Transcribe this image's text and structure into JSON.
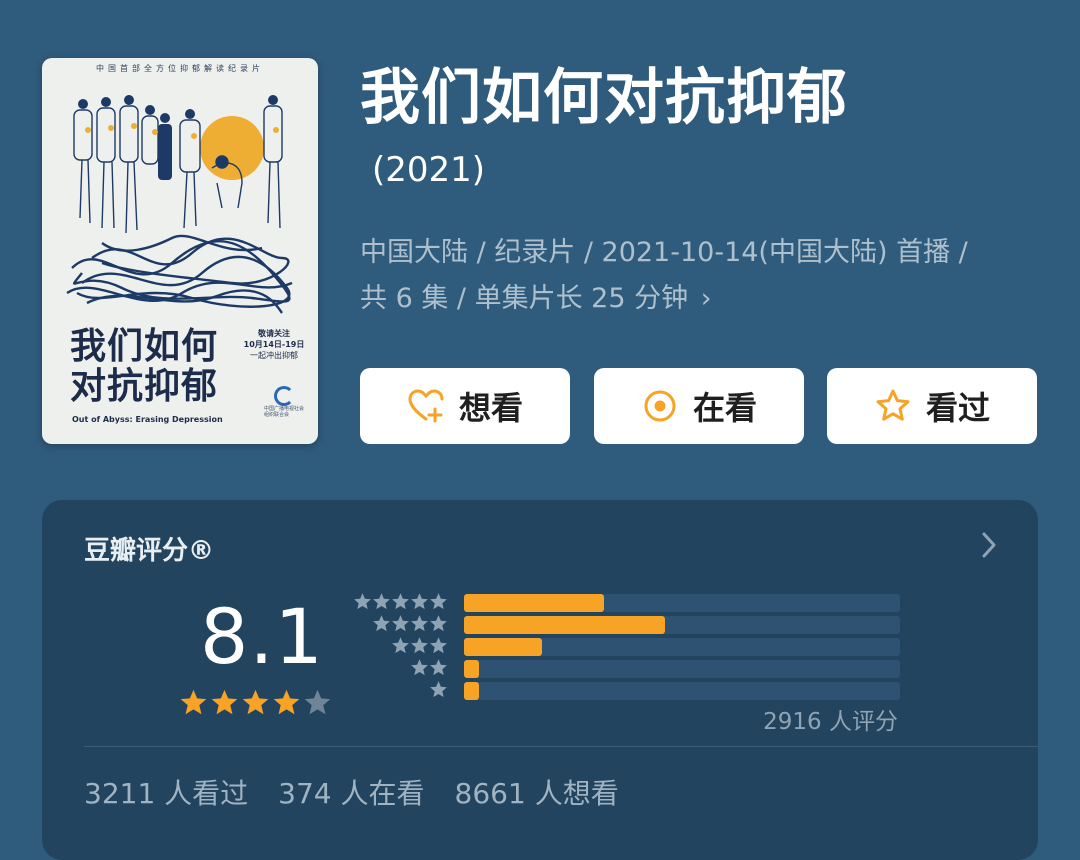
{
  "poster": {
    "tagline": "中国首部全方位抑郁解读纪录片",
    "title_line1": "我们如何",
    "title_line2": "对抗抑郁",
    "subtitle": "Out of Abyss: Erasing Depression",
    "notice_line1": "敬请关注",
    "notice_line2": "10月14日-19日",
    "notice_line3": "一起冲出抑郁",
    "logo_text": "中国广播电视社会组织联合会"
  },
  "header": {
    "title": "我们如何对抗抑郁",
    "year": "(2021)",
    "meta_line1": "中国大陆 / 纪录片 / 2021-10-14(中国大陆) 首播 /",
    "meta_line2": "共 6 集 / 单集片长 25 分钟"
  },
  "buttons": {
    "want": "想看",
    "watching": "在看",
    "watched": "看过"
  },
  "rating": {
    "title": "豆瓣评分®",
    "score": "8.1",
    "stars_filled": 4,
    "stars_total": 5,
    "count_text": "2916 人评分",
    "distribution": [
      {
        "stars": 5,
        "fraction": 0.32
      },
      {
        "stars": 4,
        "fraction": 0.46
      },
      {
        "stars": 3,
        "fraction": 0.18
      },
      {
        "stars": 2,
        "fraction": 0.035
      },
      {
        "stars": 1,
        "fraction": 0.035
      }
    ]
  },
  "stats": {
    "watched": "3211 人看过",
    "watching": "374 人在看",
    "want": "8661 人想看"
  },
  "colors": {
    "background": "#2f5b7c",
    "card": "#23445f",
    "accent": "#f7a325",
    "meta_text": "#aec0cd"
  },
  "icons": {
    "want": "heart-plus-icon",
    "watching": "target-circle-icon",
    "watched": "star-outline-icon",
    "card_arrow": "chevron-right-icon"
  }
}
